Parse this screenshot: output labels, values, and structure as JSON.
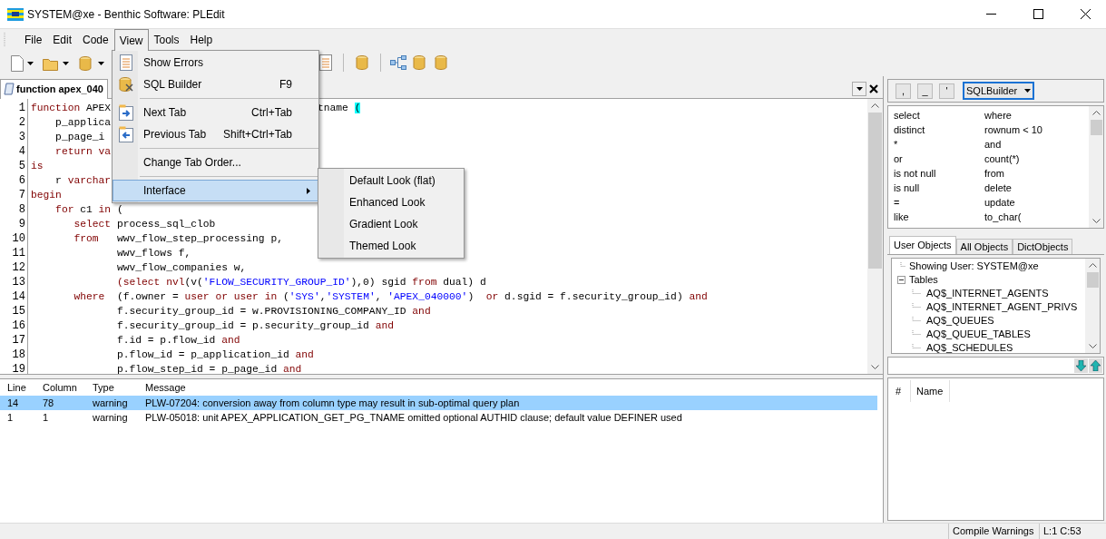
{
  "window": {
    "title": "SYSTEM@xe - Benthic Software: PLEdit"
  },
  "menu_bar": [
    {
      "label": "File",
      "selected": false
    },
    {
      "label": "Edit",
      "selected": false
    },
    {
      "label": "Code",
      "selected": false
    },
    {
      "label": "View",
      "selected": true
    },
    {
      "label": "Tools",
      "selected": false
    },
    {
      "label": "Help",
      "selected": false
    }
  ],
  "view_menu": [
    {
      "kind": "item",
      "label": "Show Errors",
      "selected": false
    },
    {
      "kind": "item",
      "label": "SQL Builder",
      "shortcut": "F9",
      "selected": false
    },
    {
      "kind": "separator"
    },
    {
      "kind": "item",
      "label": "Next Tab",
      "shortcut": "Ctrl+Tab",
      "selected": false
    },
    {
      "kind": "item",
      "label": "Previous Tab",
      "shortcut": "Shift+Ctrl+Tab",
      "selected": false
    },
    {
      "kind": "separator"
    },
    {
      "kind": "item",
      "label": "Change Tab Order...",
      "selected": false
    },
    {
      "kind": "separator"
    },
    {
      "kind": "item",
      "label": "Interface",
      "selected": true,
      "submenu": [
        "Default Look (flat)",
        "Enhanced Look",
        "Gradient Look",
        "Themed Look"
      ]
    }
  ],
  "editor_tab": {
    "title": "function apex_040"
  },
  "code_lines": [
    {
      "number": "1",
      "tokens": [
        {
          "kind": "kw",
          "text": "function"
        },
        {
          "kind": "plain",
          "text": " APEX"
        }
      ],
      "tail": [
        {
          "kind": "plain",
          "text": "tname "
        },
        {
          "kind": "hl",
          "text": "("
        }
      ]
    },
    {
      "number": "2",
      "tokens": [
        {
          "kind": "plain",
          "text": "    p_applica"
        }
      ]
    },
    {
      "number": "3",
      "tokens": [
        {
          "kind": "plain",
          "text": "    p_page_i"
        }
      ]
    },
    {
      "number": "4",
      "tokens": [
        {
          "kind": "kw",
          "text": "    return va"
        }
      ]
    },
    {
      "number": "5",
      "tokens": [
        {
          "kind": "kw",
          "text": "is"
        }
      ]
    },
    {
      "number": "6",
      "tokens": [
        {
          "kind": "plain",
          "text": "    r "
        },
        {
          "kind": "kw",
          "text": "varchar"
        }
      ]
    },
    {
      "number": "7",
      "tokens": [
        {
          "kind": "kw",
          "text": "begin"
        }
      ]
    },
    {
      "number": "8",
      "tokens": [
        {
          "kind": "kw",
          "text": "    for"
        },
        {
          "kind": "plain",
          "text": " c1 "
        },
        {
          "kind": "kw",
          "text": "in"
        },
        {
          "kind": "plain",
          "text": " ("
        }
      ]
    },
    {
      "number": "9",
      "tokens": [
        {
          "kind": "kw",
          "text": "       select"
        },
        {
          "kind": "plain",
          "text": " process_sql_clob"
        }
      ]
    },
    {
      "number": "10",
      "tokens": [
        {
          "kind": "kw",
          "text": "       from"
        },
        {
          "kind": "plain",
          "text": "   wwv_flow_step_processing p,"
        }
      ]
    },
    {
      "number": "11",
      "tokens": [
        {
          "kind": "plain",
          "text": "              wwv_flows f,"
        }
      ]
    },
    {
      "number": "12",
      "tokens": [
        {
          "kind": "plain",
          "text": "              wwv_flow_companies w,"
        }
      ]
    },
    {
      "number": "13",
      "tokens": [
        {
          "kind": "kw",
          "text": "              (select nvl"
        },
        {
          "kind": "plain",
          "text": "(v("
        },
        {
          "kind": "str",
          "text": "'FLOW_SECURITY_GROUP_ID'"
        },
        {
          "kind": "plain",
          "text": "),0) sgid "
        },
        {
          "kind": "kw",
          "text": "from"
        },
        {
          "kind": "plain",
          "text": " dual) d"
        }
      ]
    },
    {
      "number": "14",
      "tokens": [
        {
          "kind": "kw",
          "text": "       where"
        },
        {
          "kind": "plain",
          "text": "  (f.owner = "
        },
        {
          "kind": "kw",
          "text": "user or user in"
        },
        {
          "kind": "plain",
          "text": " ("
        },
        {
          "kind": "str",
          "text": "'SYS'"
        },
        {
          "kind": "plain",
          "text": ","
        },
        {
          "kind": "str",
          "text": "'SYSTEM'"
        },
        {
          "kind": "plain",
          "text": ", "
        },
        {
          "kind": "str",
          "text": "'APEX_040000'"
        },
        {
          "kind": "plain",
          "text": ")  "
        },
        {
          "kind": "kw",
          "text": "or"
        },
        {
          "kind": "plain",
          "text": " d.sgid = f.security_group_id) "
        },
        {
          "kind": "kw",
          "text": "and"
        }
      ]
    },
    {
      "number": "15",
      "tokens": [
        {
          "kind": "plain",
          "text": "              f.security_group_id = w.PROVISIONING_COMPANY_ID "
        },
        {
          "kind": "kw",
          "text": "and"
        }
      ]
    },
    {
      "number": "16",
      "tokens": [
        {
          "kind": "plain",
          "text": "              f.security_group_id = p.security_group_id "
        },
        {
          "kind": "kw",
          "text": "and"
        }
      ]
    },
    {
      "number": "17",
      "tokens": [
        {
          "kind": "plain",
          "text": "              f.id = p.flow_id "
        },
        {
          "kind": "kw",
          "text": "and"
        }
      ]
    },
    {
      "number": "18",
      "tokens": [
        {
          "kind": "plain",
          "text": "              p.flow_id = p_application_id "
        },
        {
          "kind": "kw",
          "text": "and"
        }
      ]
    },
    {
      "number": "19",
      "tokens": [
        {
          "kind": "plain",
          "text": "              p.flow_step_id = p_page_id "
        },
        {
          "kind": "kw",
          "text": "and"
        }
      ]
    }
  ],
  "messages": {
    "columns": [
      "Line",
      "Column",
      "Type",
      "Message"
    ],
    "rows": [
      {
        "cells": [
          "14",
          "78",
          "warning",
          "PLW-07204: conversion away from column type may result in sub-optimal query plan"
        ],
        "selected": true
      },
      {
        "cells": [
          "1",
          "1",
          "warning",
          "PLW-05018: unit APEX_APPLICATION_GET_PG_TNAME omitted optional AUTHID clause; default value DEFINER used"
        ],
        "selected": false
      }
    ]
  },
  "quote_buttons": [
    ",",
    "_",
    "'"
  ],
  "builder_select": "SQLBuilder",
  "keywords": [
    [
      "select",
      "where"
    ],
    [
      "distinct",
      "rownum < 10"
    ],
    [
      "*",
      "and"
    ],
    [
      "or",
      "count(*)"
    ],
    [
      "is not null",
      "from"
    ],
    [
      "is null",
      "delete"
    ],
    [
      "=",
      "update"
    ],
    [
      "like",
      "to_char("
    ]
  ],
  "object_tabs": [
    {
      "label": "User Objects",
      "selected": true
    },
    {
      "label": "All Objects",
      "selected": false
    },
    {
      "label": "DictObjects",
      "selected": false
    }
  ],
  "tree": [
    {
      "label": "Showing User: SYSTEM@xe"
    },
    {
      "label": "Tables",
      "expanded": true,
      "children": [
        {
          "label": "AQ$_INTERNET_AGENTS"
        },
        {
          "label": "AQ$_INTERNET_AGENT_PRIVS"
        },
        {
          "label": "AQ$_QUEUES"
        },
        {
          "label": "AQ$_QUEUE_TABLES"
        },
        {
          "label": "AQ$_SCHEDULES"
        }
      ]
    }
  ],
  "name_table": {
    "columns": [
      "#",
      "Name"
    ]
  },
  "status_bar": [
    "Compile Warnings",
    "L:1 C:53"
  ]
}
